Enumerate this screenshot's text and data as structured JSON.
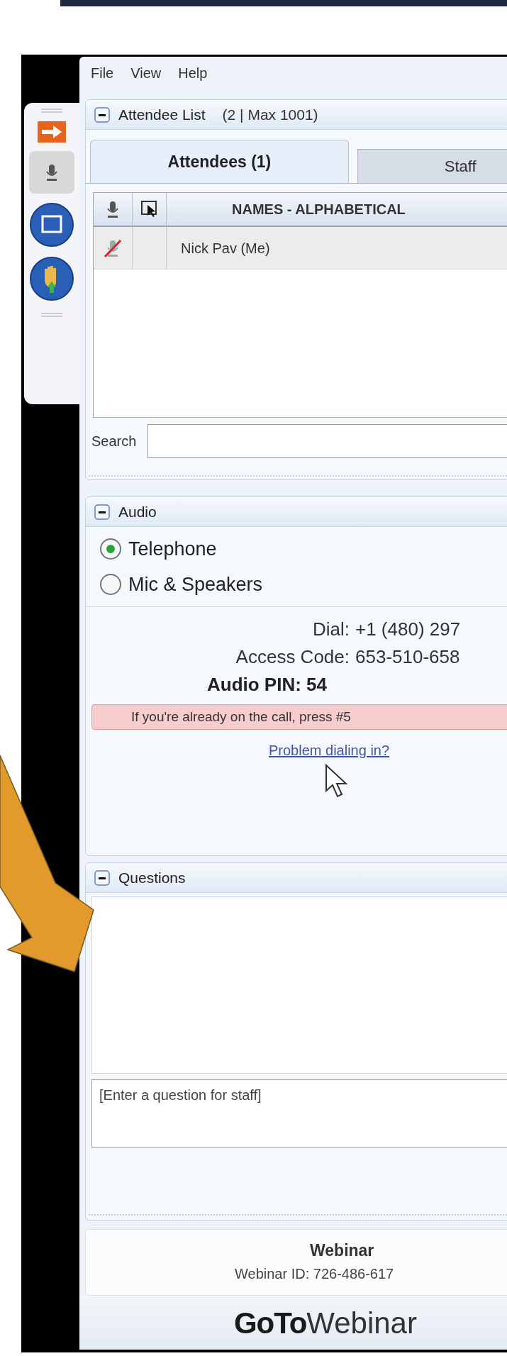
{
  "menu": [
    "File",
    "View",
    "Help"
  ],
  "attendee_panel": {
    "title": "Attendee List",
    "count": "(2 | Max 1001)",
    "expanded": true,
    "tabs": [
      {
        "label": "Attendees (1)",
        "selected": true
      },
      {
        "label": "Staff",
        "selected": false
      }
    ],
    "columns": [
      "NAMES - ALPHABETICAL"
    ],
    "rows": [
      {
        "name": "Nick Pav (Me)",
        "muted": true
      }
    ],
    "search": {
      "label": "Search"
    }
  },
  "audio_panel": {
    "title": "Audio",
    "expanded": true,
    "options": [
      {
        "label": "Telephone",
        "selected": true
      },
      {
        "label": "Mic & Speakers",
        "selected": false
      }
    ],
    "details": [
      {
        "label": "Dial:",
        "value": "+1 (480) 297"
      },
      {
        "label": "Access Code:",
        "value": "653-510-658"
      }
    ],
    "pin": "Audio PIN: 54",
    "notice": "If you're already on the call, press #5",
    "link": "Problem dialing in?"
  },
  "questions_panel": {
    "title": "Questions",
    "expanded": true,
    "input": {
      "placeholder": "[Enter a question for staff]"
    }
  },
  "webinar": {
    "title": "Webinar",
    "id": "Webinar ID: 726-486-617"
  },
  "logo": {
    "bold": "GoTo",
    "light": "Webinar"
  }
}
